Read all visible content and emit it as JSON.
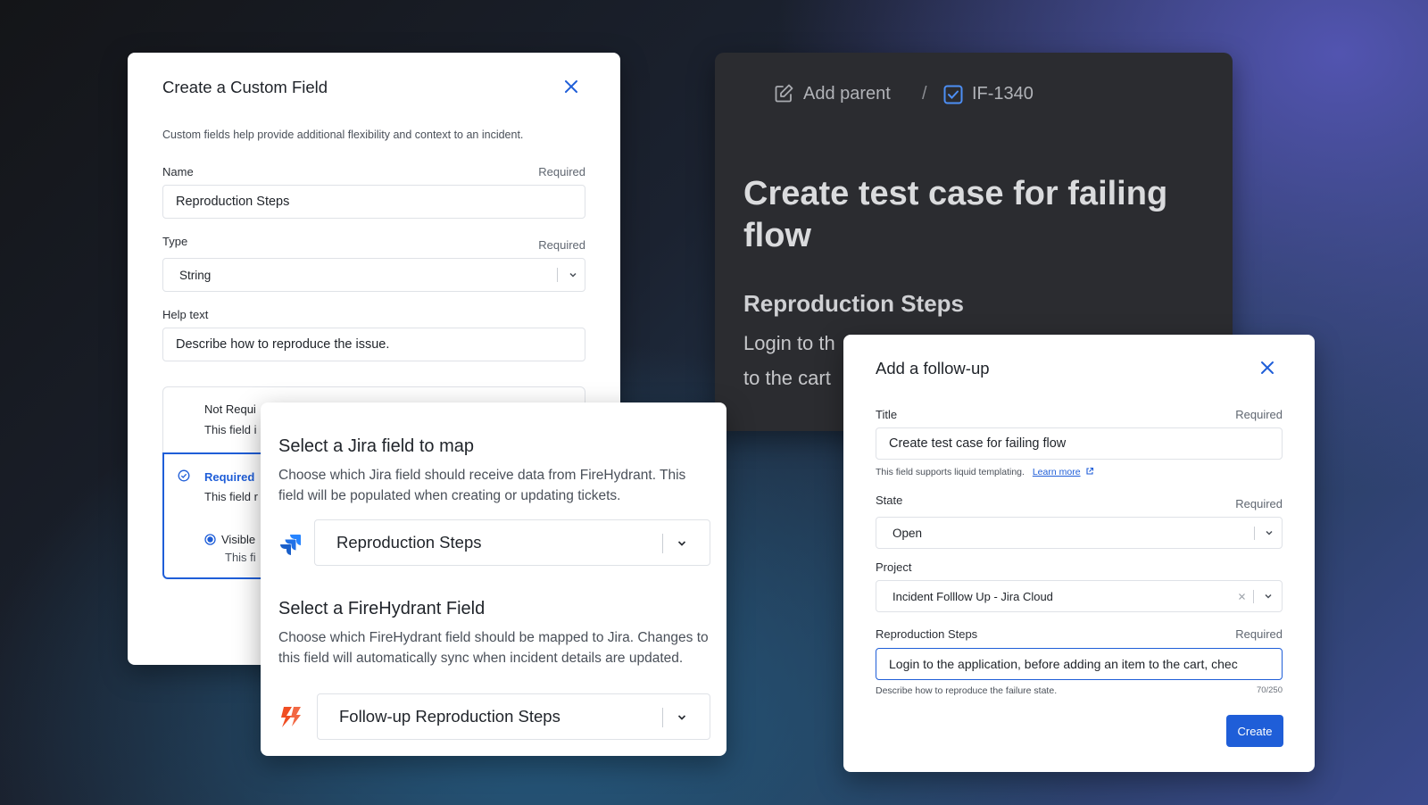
{
  "custom_field": {
    "title": "Create a Custom Field",
    "description": "Custom fields help provide additional flexibility and context to an incident.",
    "name_label": "Name",
    "name_required": "Required",
    "name_value": "Reproduction Steps",
    "type_label": "Type",
    "type_required": "Required",
    "type_value": "String",
    "help_label": "Help text",
    "help_value": "Describe how to reproduce the issue.",
    "option_not_required_title": "Not Requi",
    "option_not_required_desc": "This field i",
    "option_required_title": "Required",
    "option_required_desc": "This field r",
    "visible_label": "Visible",
    "visible_desc": "This fi"
  },
  "issue": {
    "add_parent": "Add parent",
    "separator": "/",
    "key": "IF-1340",
    "title": "Create test case for failing flow",
    "section_title": "Reproduction Steps",
    "body_line1": "Login to th",
    "body_line2": "to the cart"
  },
  "jira_map": {
    "title1": "Select a Jira field to map",
    "desc1": "Choose which Jira field should receive data from FireHydrant. This field will be populated when creating or updating tickets.",
    "select1_value": "Reproduction Steps",
    "title2": "Select a FireHydrant Field",
    "desc2": "Choose which FireHydrant field should be mapped to Jira. Changes to this field will automatically sync when incident details are updated.",
    "select2_value": "Follow-up Reproduction Steps"
  },
  "follow_up": {
    "title": "Add a follow-up",
    "title_label": "Title",
    "title_required": "Required",
    "title_value": "Create test case for failing flow",
    "title_hint": "This field supports liquid templating.",
    "learn_more": "Learn more",
    "state_label": "State",
    "state_required": "Required",
    "state_value": "Open",
    "project_label": "Project",
    "project_value": "Incident Folllow Up - Jira Cloud",
    "repro_label": "Reproduction Steps",
    "repro_required": "Required",
    "repro_value": "Login to the application, before adding an item to the cart, chec",
    "repro_hint": "Describe how to reproduce the failure state.",
    "char_count": "70/250",
    "create_button": "Create"
  },
  "colors": {
    "accent": "#1f5ed8",
    "dark_card": "#2b2c30",
    "firehydrant": "#f04e23",
    "jira": "#2684ff"
  }
}
